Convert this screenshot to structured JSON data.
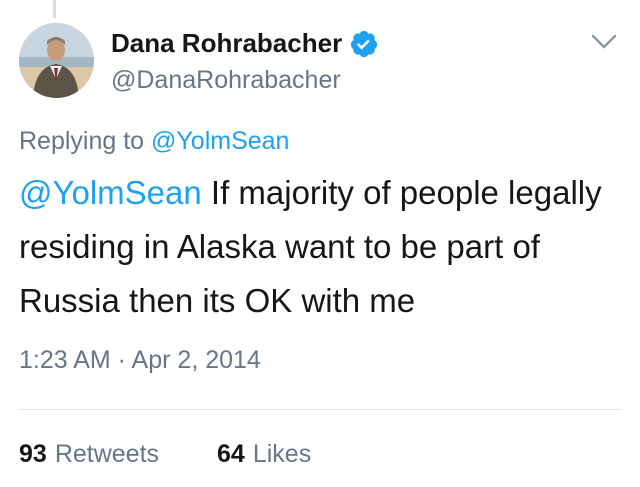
{
  "author": {
    "display_name": "Dana Rohrabacher",
    "handle": "@DanaRohrabacher",
    "verified": true
  },
  "reply_context": {
    "prefix": "Replying to",
    "handle": "@YolmSean"
  },
  "tweet": {
    "mention": "@YolmSean",
    "text": " If majority of people legally residing in Alaska want to be part of Russia then its OK with me"
  },
  "timestamp": "1:23 AM · Apr 2, 2014",
  "stats": {
    "retweets_count": "93",
    "retweets_label": "Retweets",
    "likes_count": "64",
    "likes_label": "Likes"
  },
  "icons": {
    "verified": "verified-badge-icon",
    "menu": "chevron-down-icon"
  },
  "colors": {
    "link": "#1da1f2",
    "secondary_text": "#657786",
    "primary_text": "#14171a",
    "divider": "#e1e8ed"
  }
}
